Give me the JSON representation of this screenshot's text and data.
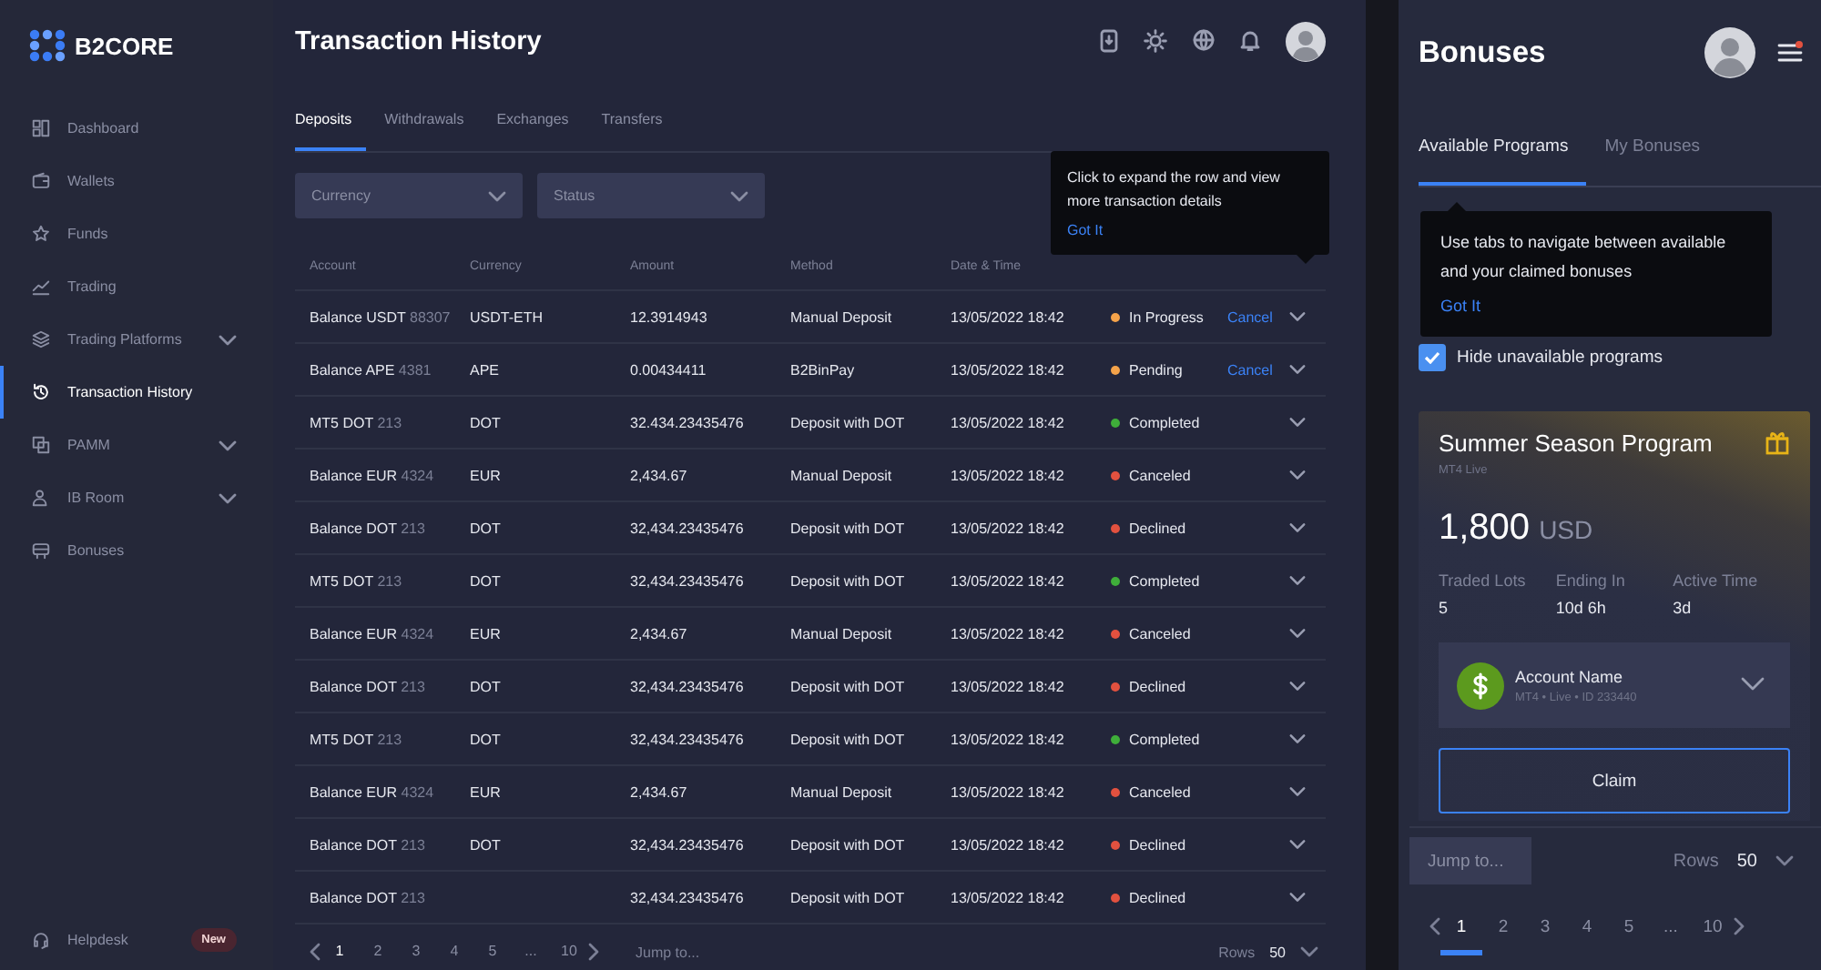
{
  "brand": {
    "name": "B2CORE"
  },
  "sidebar": {
    "items": [
      {
        "label": "Dashboard",
        "selected": false,
        "expandable": false
      },
      {
        "label": "Wallets",
        "selected": false,
        "expandable": false
      },
      {
        "label": "Funds",
        "selected": false,
        "expandable": false
      },
      {
        "label": "Trading",
        "selected": false,
        "expandable": false
      },
      {
        "label": "Trading Platforms",
        "selected": false,
        "expandable": true
      },
      {
        "label": "Transaction History",
        "selected": true,
        "expandable": false
      },
      {
        "label": "PAMM",
        "selected": false,
        "expandable": true
      },
      {
        "label": "IB Room",
        "selected": false,
        "expandable": true
      },
      {
        "label": "Bonuses",
        "selected": false,
        "expandable": false
      }
    ],
    "helpdesk": {
      "label": "Helpdesk",
      "badge": "New"
    }
  },
  "main": {
    "title": "Transaction History",
    "tabs": [
      {
        "label": "Deposits",
        "selected": true
      },
      {
        "label": "Withdrawals",
        "selected": false
      },
      {
        "label": "Exchanges",
        "selected": false
      },
      {
        "label": "Transfers",
        "selected": false
      }
    ],
    "filters": [
      {
        "placeholder": "Currency"
      },
      {
        "placeholder": "Status"
      }
    ],
    "table": {
      "columns": [
        "Account",
        "Currency",
        "Amount",
        "Method",
        "Date & Time"
      ],
      "rows": [
        {
          "account": "Balance USDT",
          "account_id": "88307",
          "currency": "USDT-ETH",
          "amount": "12.3914943",
          "method": "Manual Deposit",
          "date": "13/05/2022 18:42",
          "status": "In Progress",
          "color": "#f5a34a",
          "action": "Cancel"
        },
        {
          "account": "Balance APE",
          "account_id": "4381",
          "currency": "APE",
          "amount": "0.00434411",
          "method": "B2BinPay",
          "date": "13/05/2022 18:42",
          "status": "Pending",
          "color": "#f5a34a",
          "action": "Cancel"
        },
        {
          "account": "MT5 DOT",
          "account_id": "213",
          "currency": "DOT",
          "amount": "32.434.23435476",
          "method": "Deposit with DOT",
          "date": "13/05/2022 18:42",
          "status": "Completed",
          "color": "#3fae3a"
        },
        {
          "account": "Balance EUR",
          "account_id": "4324",
          "currency": "EUR",
          "amount": "2,434.67",
          "method": "Manual Deposit",
          "date": "13/05/2022 18:42",
          "status": "Canceled",
          "color": "#e2513f"
        },
        {
          "account": "Balance DOT",
          "account_id": "213",
          "currency": "DOT",
          "amount": "32,434.23435476",
          "method": "Deposit with DOT",
          "date": "13/05/2022 18:42",
          "status": "Declined",
          "color": "#e2513f"
        },
        {
          "account": "MT5 DOT",
          "account_id": "213",
          "currency": "DOT",
          "amount": "32,434.23435476",
          "method": "Deposit with DOT",
          "date": "13/05/2022 18:42",
          "status": "Completed",
          "color": "#3fae3a"
        },
        {
          "account": "Balance EUR",
          "account_id": "4324",
          "currency": "EUR",
          "amount": "2,434.67",
          "method": "Manual Deposit",
          "date": "13/05/2022 18:42",
          "status": "Canceled",
          "color": "#e2513f"
        },
        {
          "account": "Balance DOT",
          "account_id": "213",
          "currency": "DOT",
          "amount": "32,434.23435476",
          "method": "Deposit with DOT",
          "date": "13/05/2022 18:42",
          "status": "Declined",
          "color": "#e2513f"
        },
        {
          "account": "MT5 DOT",
          "account_id": "213",
          "currency": "DOT",
          "amount": "32,434.23435476",
          "method": "Deposit with DOT",
          "date": "13/05/2022 18:42",
          "status": "Completed",
          "color": "#3fae3a"
        },
        {
          "account": "Balance EUR",
          "account_id": "4324",
          "currency": "EUR",
          "amount": "2,434.67",
          "method": "Manual Deposit",
          "date": "13/05/2022 18:42",
          "status": "Canceled",
          "color": "#e2513f"
        },
        {
          "account": "Balance DOT",
          "account_id": "213",
          "currency": "DOT",
          "amount": "32,434.23435476",
          "method": "Deposit with DOT",
          "date": "13/05/2022 18:42",
          "status": "Declined",
          "color": "#e2513f"
        },
        {
          "account": "Balance DOT",
          "account_id": "213",
          "amount": "32,434.23435476",
          "method": "Deposit with DOT",
          "date": "13/05/2022 18:42",
          "status": "Declined",
          "color": "#e2513f"
        }
      ]
    },
    "pagination": {
      "pages": [
        {
          "label": "1",
          "selected": true
        },
        {
          "label": "2",
          "selected": false
        },
        {
          "label": "3",
          "selected": false
        },
        {
          "label": "4",
          "selected": false
        },
        {
          "label": "5",
          "selected": false
        },
        {
          "label": "...",
          "selected": false
        },
        {
          "label": "10",
          "selected": false
        }
      ],
      "jump_placeholder": "Jump to...",
      "rows_label": "Rows",
      "rows_value": "50"
    },
    "tooltip": {
      "text": "Click to expand the row and view more transaction details",
      "action": "Got It"
    }
  },
  "bonuses": {
    "title": "Bonuses",
    "tabs": [
      {
        "label": "Available Programs",
        "selected": true
      },
      {
        "label": "My Bonuses",
        "selected": false
      }
    ],
    "tooltip": {
      "text": "Use tabs to navigate between available and your claimed bonuses",
      "action": "Got It"
    },
    "hide_unavailable": {
      "label": "Hide unavailable programs",
      "checked": true
    },
    "card": {
      "title": "Summer Season Program",
      "subtitle": "MT4 Live",
      "amount": "1,800",
      "currency": "USD",
      "stats": [
        {
          "label": "Traded Lots",
          "value": "5"
        },
        {
          "label": "Ending In",
          "value": "10d 6h"
        },
        {
          "label": "Active Time",
          "value": "3d"
        }
      ],
      "account": {
        "name": "Account Name",
        "details": "MT4 • Live • ID 233440"
      },
      "button": "Claim"
    },
    "pagination": {
      "jump_placeholder": "Jump to...",
      "rows_label": "Rows",
      "rows_value": "50",
      "pages": [
        {
          "label": "1",
          "selected": true
        },
        {
          "label": "2",
          "selected": false
        },
        {
          "label": "3",
          "selected": false
        },
        {
          "label": "4",
          "selected": false
        },
        {
          "label": "5",
          "selected": false
        },
        {
          "label": "...",
          "selected": false
        },
        {
          "label": "10",
          "selected": false
        }
      ]
    }
  }
}
